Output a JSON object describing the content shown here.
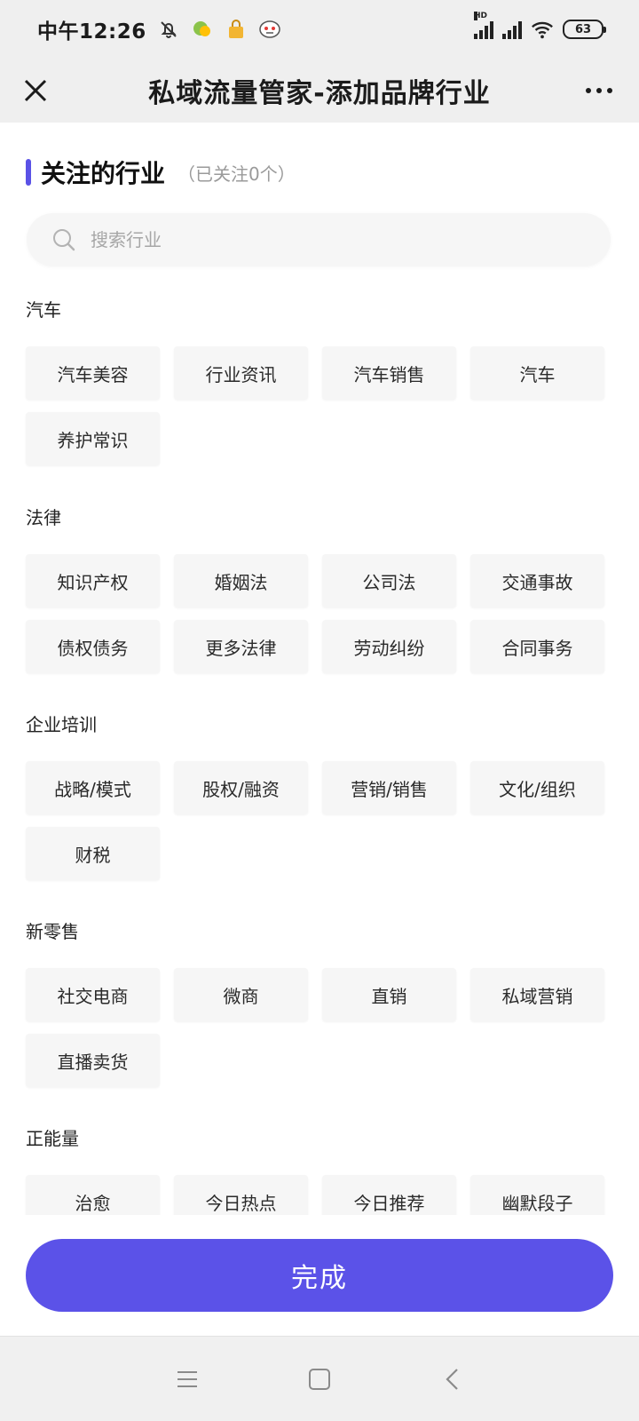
{
  "status_bar": {
    "time": "中午12:26",
    "network_label": "HD",
    "battery": "63",
    "icons": [
      "bell-off-icon",
      "chat-app-icon",
      "lock-app-icon",
      "face-app-icon",
      "signal-icon",
      "signal-icon",
      "wifi-icon",
      "battery-icon"
    ]
  },
  "header": {
    "title": "私域流量管家-添加品牌行业",
    "close_icon": "close-icon",
    "more_icon": "more-dots-icon"
  },
  "section": {
    "title": "关注的行业",
    "count": "（已关注0个）",
    "accent_color": "#5a52e6"
  },
  "search": {
    "placeholder": "搜索行业",
    "value": ""
  },
  "categories": [
    {
      "label": "汽车",
      "tags": [
        "汽车美容",
        "行业资讯",
        "汽车销售",
        "汽车",
        "养护常识"
      ]
    },
    {
      "label": "法律",
      "tags": [
        "知识产权",
        "婚姻法",
        "公司法",
        "交通事故",
        "债权债务",
        "更多法律",
        "劳动纠纷",
        "合同事务"
      ]
    },
    {
      "label": "企业培训",
      "tags": [
        "战略/模式",
        "股权/融资",
        "营销/销售",
        "文化/组织",
        "财税"
      ]
    },
    {
      "label": "新零售",
      "tags": [
        "社交电商",
        "微商",
        "直销",
        "私域营销",
        "直播卖货"
      ]
    },
    {
      "label": "正能量",
      "tags": [
        "治愈",
        "今日热点",
        "今日推荐",
        "幽默段子"
      ]
    }
  ],
  "footer": {
    "done_label": "完成",
    "button_color": "#5b52e8"
  },
  "nav": {
    "icons": [
      "menu-icon",
      "home-icon",
      "back-icon"
    ]
  }
}
